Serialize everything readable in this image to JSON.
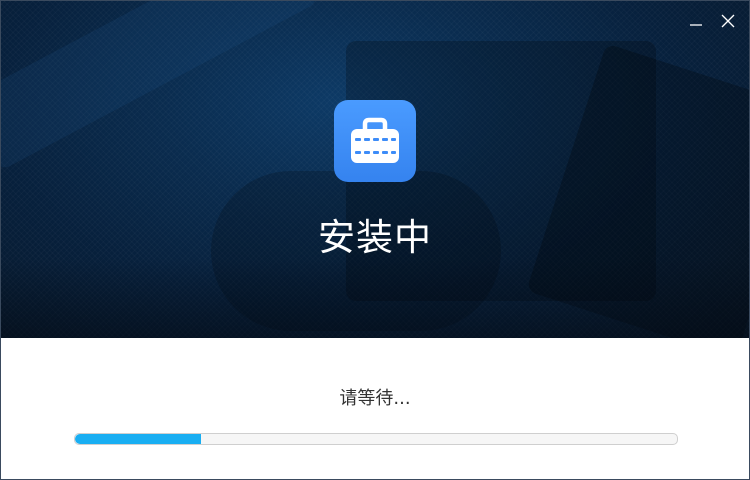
{
  "window": {
    "title": "安装中",
    "minimize_icon": "minimize-icon",
    "close_icon": "close-icon"
  },
  "hero": {
    "app_icon": "toolbox-icon",
    "title": "安装中"
  },
  "status": {
    "message": "请等待..."
  },
  "progress": {
    "fraction": 0.21,
    "fill_color": "#19aef2"
  },
  "colors": {
    "icon_bg": "#3d8cf8",
    "hero_bg": "#0a2c4f"
  }
}
